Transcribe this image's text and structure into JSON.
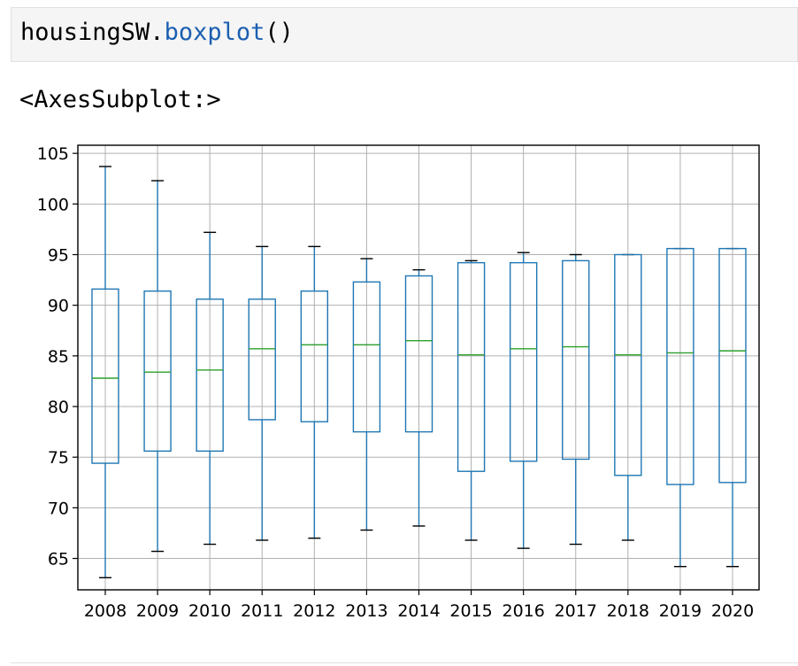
{
  "cell": {
    "code_object": "housingSW.",
    "code_method": "boxplot",
    "code_args": "()"
  },
  "output": {
    "repr": "<AxesSubplot:>"
  },
  "colors": {
    "box": "#1f77b4",
    "median": "#2ca02c",
    "whisker_cap": "#000000",
    "grid": "#b0b0b0"
  },
  "chart_data": {
    "type": "box",
    "title": "",
    "xlabel": "",
    "ylabel": "",
    "ylim": [
      61.9,
      105.8
    ],
    "yticks": [
      65,
      70,
      75,
      80,
      85,
      90,
      95,
      100,
      105
    ],
    "grid": true,
    "categories": [
      "2008",
      "2009",
      "2010",
      "2011",
      "2012",
      "2013",
      "2014",
      "2015",
      "2016",
      "2017",
      "2018",
      "2019",
      "2020"
    ],
    "boxes": [
      {
        "whisker_low": 63.1,
        "q1": 74.4,
        "median": 82.8,
        "q3": 91.6,
        "whisker_high": 103.7
      },
      {
        "whisker_low": 65.7,
        "q1": 75.6,
        "median": 83.4,
        "q3": 91.4,
        "whisker_high": 102.3
      },
      {
        "whisker_low": 66.4,
        "q1": 75.6,
        "median": 83.6,
        "q3": 90.6,
        "whisker_high": 97.2
      },
      {
        "whisker_low": 66.8,
        "q1": 78.7,
        "median": 85.7,
        "q3": 90.6,
        "whisker_high": 95.8
      },
      {
        "whisker_low": 67.0,
        "q1": 78.5,
        "median": 86.1,
        "q3": 91.4,
        "whisker_high": 95.8
      },
      {
        "whisker_low": 67.8,
        "q1": 77.5,
        "median": 86.1,
        "q3": 92.3,
        "whisker_high": 94.6
      },
      {
        "whisker_low": 68.2,
        "q1": 77.5,
        "median": 86.5,
        "q3": 92.9,
        "whisker_high": 93.5
      },
      {
        "whisker_low": 66.8,
        "q1": 73.6,
        "median": 85.1,
        "q3": 94.2,
        "whisker_high": 94.4
      },
      {
        "whisker_low": 66.0,
        "q1": 74.6,
        "median": 85.7,
        "q3": 94.2,
        "whisker_high": 95.2
      },
      {
        "whisker_low": 66.4,
        "q1": 74.8,
        "median": 85.9,
        "q3": 94.4,
        "whisker_high": 95.0
      },
      {
        "whisker_low": 66.8,
        "q1": 73.2,
        "median": 85.1,
        "q3": 95.0,
        "whisker_high": 95.0
      },
      {
        "whisker_low": 64.2,
        "q1": 72.3,
        "median": 85.3,
        "q3": 95.6,
        "whisker_high": 95.6
      },
      {
        "whisker_low": 64.2,
        "q1": 72.5,
        "median": 85.5,
        "q3": 95.6,
        "whisker_high": 95.6
      }
    ]
  }
}
